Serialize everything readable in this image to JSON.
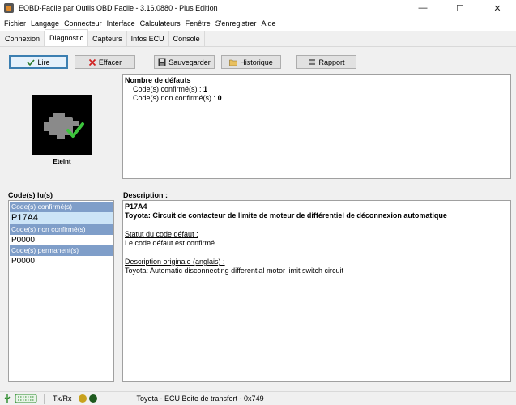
{
  "window": {
    "title": "EOBD-Facile par Outils OBD Facile - 3.16.0880 - Plus Edition",
    "minimize": "—",
    "maximize": "☐",
    "close": "✕"
  },
  "menu": [
    "Fichier",
    "Langage",
    "Connecteur",
    "Interface",
    "Calculateurs",
    "Fenêtre",
    "S'enregistrer",
    "Aide"
  ],
  "tabs": [
    "Connexion",
    "Diagnostic",
    "Capteurs",
    "Infos ECU",
    "Console"
  ],
  "active_tab": "Diagnostic",
  "toolbar": {
    "read": "Lire",
    "clear": "Effacer",
    "save": "Sauvegarder",
    "history": "Historique",
    "report": "Rapport"
  },
  "engine": {
    "status": "Eteint",
    "accent": "#3cc43c"
  },
  "faults": {
    "title": "Nombre de défauts",
    "confirmed_label": "Code(s) confirmé(s) :",
    "confirmed_count": "1",
    "unconfirmed_label": "Code(s) non confirmé(s) :",
    "unconfirmed_count": "0"
  },
  "codes": {
    "title": "Code(s) lu(s)",
    "groups": [
      {
        "header": "Code(s) confirmé(s)",
        "code": "P17A4"
      },
      {
        "header": "Code(s) non confirmé(s)",
        "code": "P0000"
      },
      {
        "header": "Code(s) permanent(s)",
        "code": "P0000"
      }
    ]
  },
  "description": {
    "title": "Description :",
    "code": "P17A4",
    "summary": "Toyota: Circuit de contacteur de limite de moteur de différentiel de déconnexion automatique",
    "status_title": "Statut du code défaut :",
    "status_text": "Le code défaut est confirmé",
    "original_title": "Description originale (anglais) :",
    "original_text": "Toyota: Automatic disconnecting differential motor limit switch circuit"
  },
  "status_bar": {
    "txrx": "Tx/Rx",
    "ecu": "Toyota - ECU Boite de transfert - 0x749",
    "led_tx": "#c8a21e",
    "led_rx": "#1e5a1e"
  }
}
